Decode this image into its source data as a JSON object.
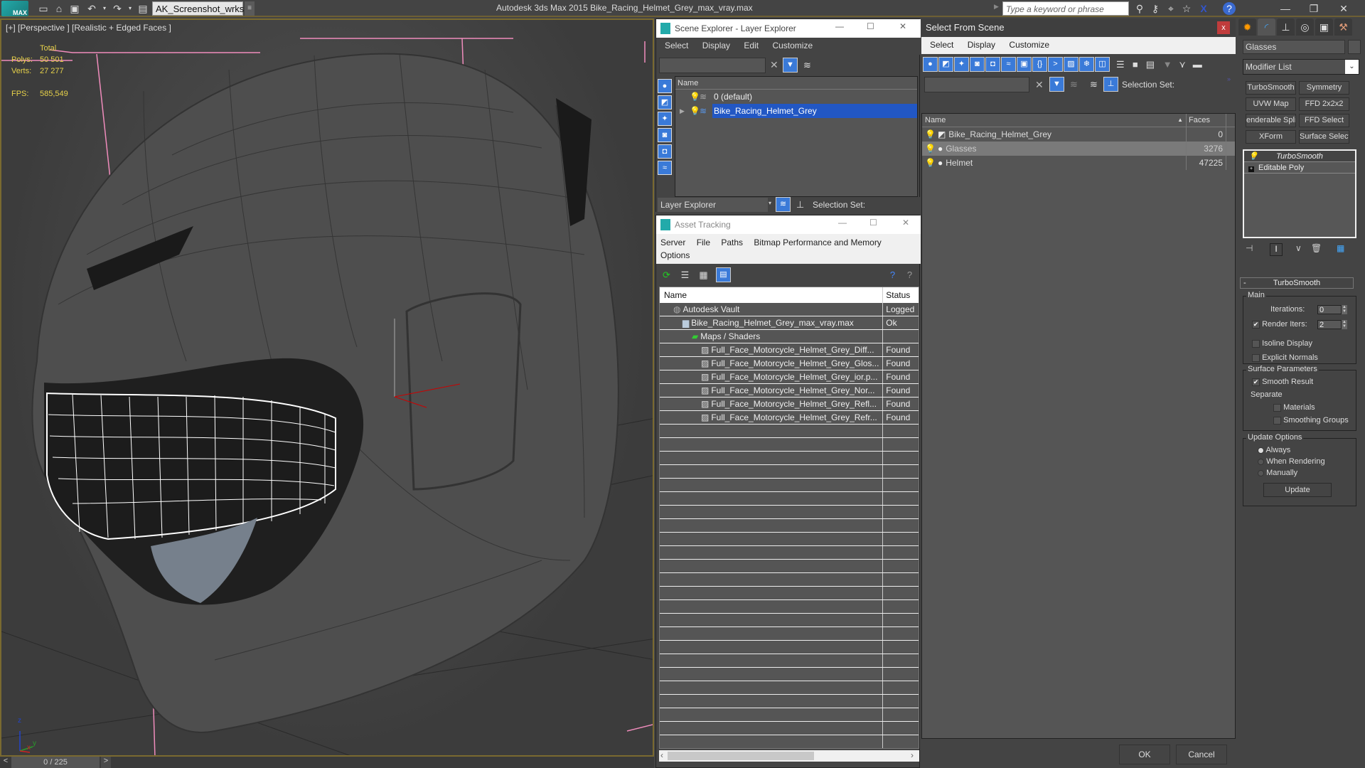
{
  "app": {
    "title": "Autodesk 3ds Max  2015    Bike_Racing_Helmet_Grey_max_vray.max",
    "logo": "MAX",
    "workspace": "AK_Screenshot_wrksp",
    "search_placeholder": "Type a keyword or phrase",
    "quick_access_icons": [
      "new-file-icon",
      "open-file-icon",
      "save-icon",
      "undo-icon",
      "redo-icon",
      "project-folder-icon"
    ],
    "header_icons": [
      "binoculars-icon",
      "key-icon",
      "satellite-icon",
      "star-icon",
      "x-icon",
      "help-icon"
    ],
    "window_controls": [
      "minimize",
      "restore",
      "close"
    ]
  },
  "viewport": {
    "label": "[+] [Perspective ] [Realistic + Edged Faces ]",
    "stats": {
      "total_label": "Total",
      "polys_label": "Polys:",
      "polys": "50 501",
      "verts_label": "Verts:",
      "verts": "27 277",
      "fps_label": "FPS:",
      "fps": "585,549"
    },
    "axis": {
      "z": "z",
      "x": "x",
      "y": "y"
    }
  },
  "timeline": {
    "prev": "<",
    "value": "0 / 225",
    "next": ">"
  },
  "scene_explorer": {
    "title": "Scene Explorer - Layer Explorer",
    "menu": [
      "Select",
      "Display",
      "Edit",
      "Customize"
    ],
    "column_name": "Name",
    "rows": [
      {
        "label": "0 (default)",
        "selected": false
      },
      {
        "label": "Bike_Racing_Helmet_Grey",
        "selected": true
      }
    ],
    "footer_mode": "Layer Explorer",
    "selection_set_label": "Selection Set:"
  },
  "asset_tracking": {
    "title": "Asset Tracking",
    "menu": [
      "Server",
      "File",
      "Paths",
      "Bitmap Performance and Memory",
      "Options"
    ],
    "columns": [
      "Name",
      "Status"
    ],
    "rows": [
      {
        "name": "Autodesk Vault",
        "status": "Logged",
        "indent": 1
      },
      {
        "name": "Bike_Racing_Helmet_Grey_max_vray.max",
        "status": "Ok",
        "indent": 2
      },
      {
        "name": "Maps / Shaders",
        "status": "",
        "indent": 3
      },
      {
        "name": "Full_Face_Motorcycle_Helmet_Grey_Diff...",
        "status": "Found",
        "indent": 4
      },
      {
        "name": "Full_Face_Motorcycle_Helmet_Grey_Glos...",
        "status": "Found",
        "indent": 4
      },
      {
        "name": "Full_Face_Motorcycle_Helmet_Grey_ior.p...",
        "status": "Found",
        "indent": 4
      },
      {
        "name": "Full_Face_Motorcycle_Helmet_Grey_Nor...",
        "status": "Found",
        "indent": 4
      },
      {
        "name": "Full_Face_Motorcycle_Helmet_Grey_Refl...",
        "status": "Found",
        "indent": 4
      },
      {
        "name": "Full_Face_Motorcycle_Helmet_Grey_Refr...",
        "status": "Found",
        "indent": 4
      }
    ]
  },
  "select_from_scene": {
    "title": "Select From Scene",
    "close": "x",
    "menu": [
      "Select",
      "Display",
      "Customize"
    ],
    "selection_set_label": "Selection Set:",
    "columns": {
      "name": "Name",
      "faces": "Faces"
    },
    "rows": [
      {
        "name": "Bike_Racing_Helmet_Grey",
        "faces": "0",
        "highlight": false
      },
      {
        "name": "Glasses",
        "faces": "3276",
        "highlight": true
      },
      {
        "name": "Helmet",
        "faces": "47225",
        "highlight": false
      }
    ],
    "ok_label": "OK",
    "cancel_label": "Cancel"
  },
  "command_panel": {
    "object_name": "Glasses",
    "modifier_list": "Modifier List",
    "modifier_buttons": [
      "TurboSmooth",
      "Symmetry",
      "UVW Map",
      "FFD 2x2x2",
      "enderable Splin",
      "FFD Select",
      "XForm",
      "Surface Select"
    ],
    "stack": [
      "TurboSmooth",
      "Editable Poly"
    ],
    "turbosmooth": {
      "title": "TurboSmooth",
      "collapse": "-",
      "main_label": "Main",
      "iterations_label": "Iterations:",
      "iterations": "0",
      "render_iters_label": "Render Iters:",
      "render_iters": "2",
      "render_iters_checked": true,
      "isoline_label": "Isoline Display",
      "isoline_checked": false,
      "explicit_normals_label": "Explicit Normals",
      "explicit_normals_checked": false,
      "surface_params_label": "Surface Parameters",
      "smooth_result_label": "Smooth Result",
      "smooth_result_checked": true,
      "separate_label": "Separate",
      "materials_label": "Materials",
      "smoothing_groups_label": "Smoothing Groups",
      "update_options_label": "Update Options",
      "update_options": [
        "Always",
        "When Rendering",
        "Manually"
      ],
      "update_selected": "Always",
      "update_button": "Update"
    }
  },
  "colors": {
    "selection_blue": "#2257c4",
    "viewport_border": "#7a6a30",
    "stats_yellow": "#e6d14a",
    "close_red": "#c03c3c"
  }
}
